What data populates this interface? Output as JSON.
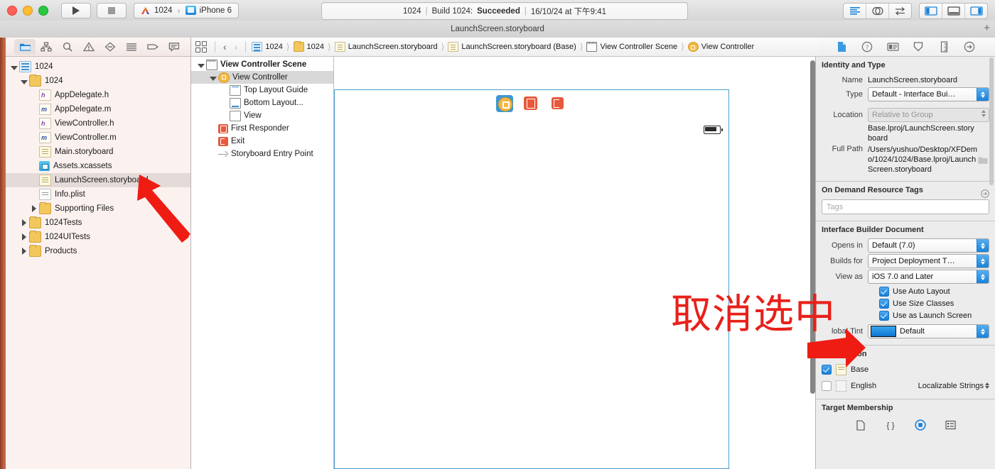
{
  "titlebar": {
    "run_tooltip": "Run",
    "stop_tooltip": "Stop",
    "scheme_name": "1024",
    "scheme_separator": "›",
    "destination": "iPhone 6",
    "status": {
      "project": "1024",
      "sep1": "|",
      "build_prefix": "Build 1024:",
      "build_result": "Succeeded",
      "sep2": "|",
      "timestamp": "16/10/24 at 下午9:41"
    },
    "editor_icons": [
      "standard-editor-icon",
      "assistant-editor-icon",
      "version-editor-icon"
    ],
    "view_icons": [
      "navigator-toggle-icon",
      "debug-area-toggle-icon",
      "utilities-toggle-icon"
    ]
  },
  "tabbar": {
    "title": "LaunchScreen.storyboard",
    "add_tab": "+"
  },
  "navigator": {
    "toolbar_icons": [
      "project-navigator-icon",
      "symbol-navigator-icon",
      "find-navigator-icon",
      "issue-navigator-icon",
      "test-navigator-icon",
      "debug-navigator-icon",
      "breakpoint-navigator-icon",
      "report-navigator-icon"
    ],
    "items": [
      {
        "label": "1024",
        "icon": "project-icon",
        "indent": 0,
        "twisty": "down",
        "selected": false
      },
      {
        "label": "1024",
        "icon": "folder-icon",
        "indent": 1,
        "twisty": "down",
        "selected": false
      },
      {
        "label": "AppDelegate.h",
        "icon": "header-file-icon",
        "indent": 2,
        "twisty": "none",
        "selected": false
      },
      {
        "label": "AppDelegate.m",
        "icon": "source-file-icon",
        "indent": 2,
        "twisty": "none",
        "selected": false
      },
      {
        "label": "ViewController.h",
        "icon": "header-file-icon",
        "indent": 2,
        "twisty": "none",
        "selected": false
      },
      {
        "label": "ViewController.m",
        "icon": "source-file-icon",
        "indent": 2,
        "twisty": "none",
        "selected": false
      },
      {
        "label": "Main.storyboard",
        "icon": "storyboard-icon",
        "indent": 2,
        "twisty": "none",
        "selected": false
      },
      {
        "label": "Assets.xcassets",
        "icon": "assets-icon",
        "indent": 2,
        "twisty": "none",
        "selected": false
      },
      {
        "label": "LaunchScreen.storyboard",
        "icon": "storyboard-icon",
        "indent": 2,
        "twisty": "none",
        "selected": true
      },
      {
        "label": "Info.plist",
        "icon": "plist-icon",
        "indent": 2,
        "twisty": "none",
        "selected": false
      },
      {
        "label": "Supporting Files",
        "icon": "folder-icon",
        "indent": 2,
        "twisty": "right",
        "selected": false
      },
      {
        "label": "1024Tests",
        "icon": "folder-icon",
        "indent": 1,
        "twisty": "right",
        "selected": false
      },
      {
        "label": "1024UITests",
        "icon": "folder-icon",
        "indent": 1,
        "twisty": "right",
        "selected": false
      },
      {
        "label": "Products",
        "icon": "folder-icon",
        "indent": 1,
        "twisty": "right",
        "selected": false
      }
    ]
  },
  "jumpbar": {
    "related_items_icon": "related-items-icon",
    "back_arrow": "‹",
    "forward_arrow": "›",
    "crumbs": [
      {
        "label": "1024",
        "icon": "project-icon"
      },
      {
        "label": "1024",
        "icon": "folder-icon"
      },
      {
        "label": "LaunchScreen.storyboard",
        "icon": "storyboard-icon"
      },
      {
        "label": "LaunchScreen.storyboard (Base)",
        "icon": "storyboard-icon"
      },
      {
        "label": "View Controller Scene",
        "icon": "scene-icon"
      },
      {
        "label": "View Controller",
        "icon": "view-controller-icon"
      }
    ]
  },
  "outline": {
    "items": [
      {
        "label": "View Controller Scene",
        "icon": "scene-icon",
        "indent": 0,
        "twisty": "down",
        "bold": true,
        "selected": false
      },
      {
        "label": "View Controller",
        "icon": "view-controller-icon",
        "indent": 1,
        "twisty": "down",
        "bold": false,
        "selected": true
      },
      {
        "label": "Top Layout Guide",
        "icon": "top-layout-guide-icon",
        "indent": 2,
        "twisty": "none",
        "bold": false,
        "selected": false
      },
      {
        "label": "Bottom Layout...",
        "icon": "bottom-layout-guide-icon",
        "indent": 2,
        "twisty": "none",
        "bold": false,
        "selected": false
      },
      {
        "label": "View",
        "icon": "view-icon",
        "indent": 2,
        "twisty": "none",
        "bold": false,
        "selected": false
      },
      {
        "label": "First Responder",
        "icon": "first-responder-icon",
        "indent": 1,
        "twisty": "none",
        "bold": false,
        "selected": false
      },
      {
        "label": "Exit",
        "icon": "exit-icon",
        "indent": 1,
        "twisty": "none",
        "bold": false,
        "selected": false
      },
      {
        "label": "Storyboard Entry Point",
        "icon": "storyboard-entry-point-icon",
        "indent": 1,
        "twisty": "none",
        "bold": false,
        "selected": false
      }
    ]
  },
  "canvas": {
    "dock_icons": [
      "view-controller-dock-icon",
      "first-responder-dock-icon",
      "exit-dock-icon"
    ],
    "status_bar_icon": "battery-icon"
  },
  "inspector": {
    "toolbar_icons": [
      "file-inspector-icon",
      "quick-help-inspector-icon",
      "identity-inspector-icon",
      "attributes-inspector-icon",
      "size-inspector-icon",
      "connections-inspector-icon"
    ],
    "identity_and_type": {
      "title": "Identity and Type",
      "name_label": "Name",
      "name_value": "LaunchScreen.storyboard",
      "type_label": "Type",
      "type_value": "Default - Interface Bui…",
      "location_label": "Location",
      "location_value": "Relative to Group",
      "location_path": "Base.lproj/LaunchScreen.storyboard",
      "full_path_label": "Full Path",
      "full_path_value": "/Users/yushuo/Desktop/XFDemo/1024/1024/Base.lproj/LaunchScreen.storyboard"
    },
    "on_demand": {
      "title": "On Demand Resource Tags",
      "tags_placeholder": "Tags",
      "tags_value": ""
    },
    "ib_document": {
      "title": "Interface Builder Document",
      "opens_in_label": "Opens in",
      "opens_in_value": "Default (7.0)",
      "builds_for_label": "Builds for",
      "builds_for_value": "Project Deployment T…",
      "view_as_label": "View as",
      "view_as_value": "iOS 7.0 and Later",
      "checkboxes": [
        {
          "label": "Use Auto Layout",
          "checked": true
        },
        {
          "label": "Use Size Classes",
          "checked": true
        },
        {
          "label": "Use as Launch Screen",
          "checked": true
        }
      ],
      "global_tint_label": "lobal Tint",
      "global_tint_value": "Default",
      "global_tint_color": "#1d86dd"
    },
    "localization": {
      "title": "Localization",
      "rows": [
        {
          "label": "Base",
          "checked": true,
          "right": "",
          "icon": "storyboard-icon"
        },
        {
          "label": "English",
          "checked": false,
          "right": "Localizable Strings",
          "icon": "empty-file-icon"
        }
      ]
    },
    "target_membership": {
      "title": "Target Membership",
      "icons": [
        "file-target-icon",
        "code-target-icon",
        "app-target-icon",
        "resource-target-icon"
      ]
    }
  },
  "annotations": {
    "text": "取消选中",
    "color": "#e8201a",
    "arrows": [
      "arrow-to-launchscreen-file",
      "arrow-to-use-as-launch-screen-checkbox"
    ]
  }
}
